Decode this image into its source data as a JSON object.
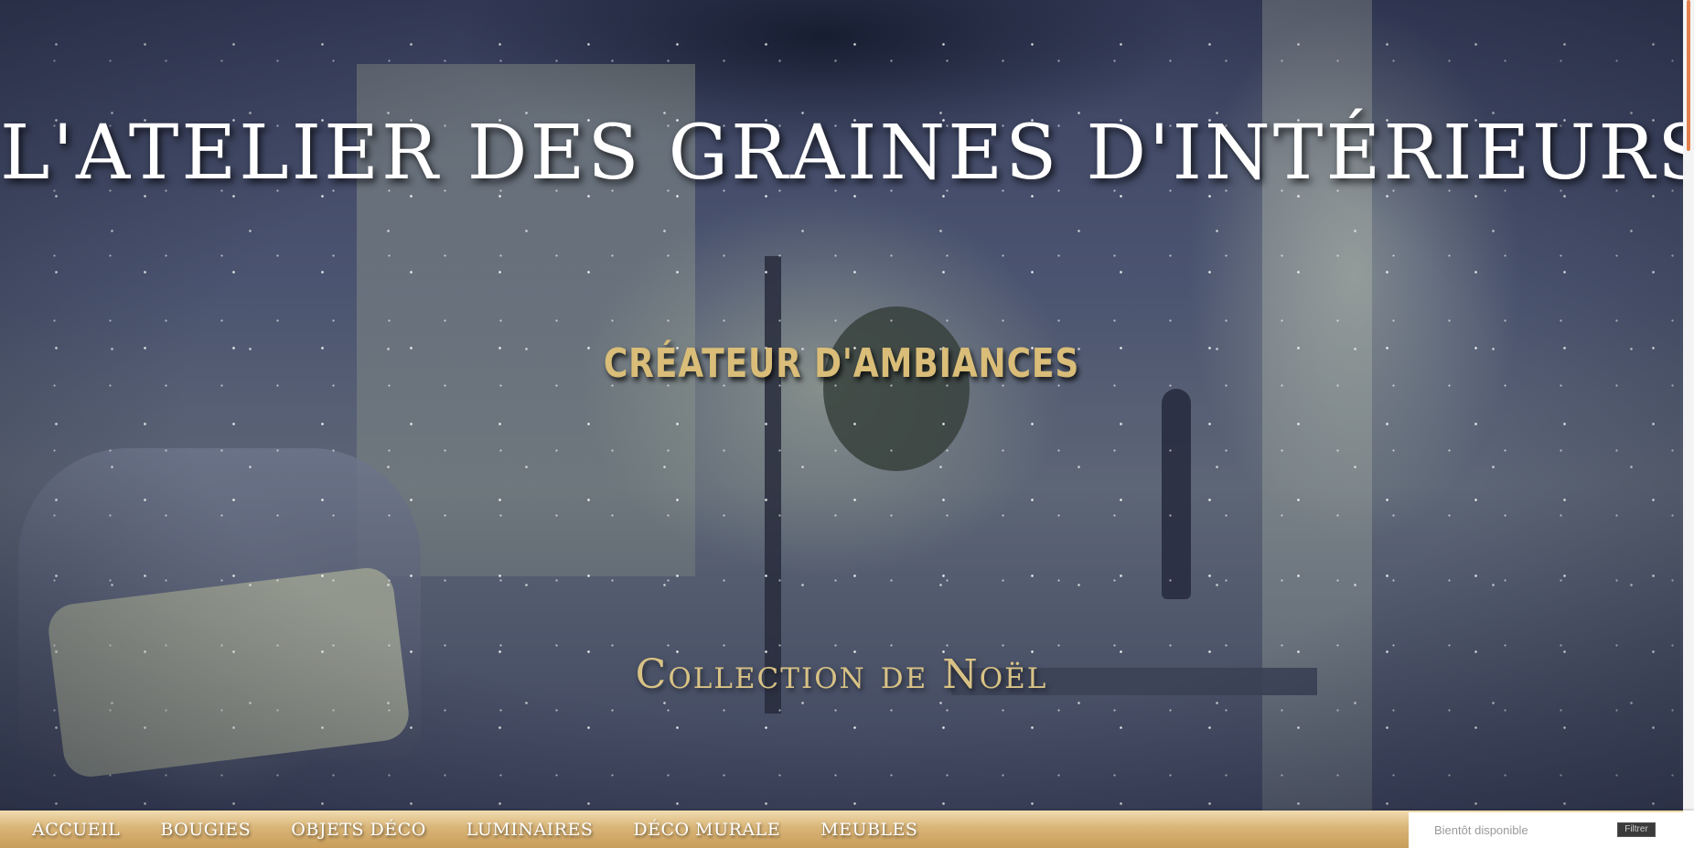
{
  "hero": {
    "title": "L'ATELIER DES GRAINES D'INTÉRIEURS",
    "subtitle": "CRÉATEUR D'AMBIANCES",
    "collection": "Collection de Noël"
  },
  "nav": {
    "items": [
      {
        "label": "ACCUEIL"
      },
      {
        "label": "BOUGIES"
      },
      {
        "label": "OBJETS DÉCO"
      },
      {
        "label": "LUMINAIRES"
      },
      {
        "label": "DÉCO MURALE"
      },
      {
        "label": "MEUBLES"
      }
    ]
  },
  "search": {
    "placeholder": "Bientôt disponible",
    "button_label": "Filtrer"
  },
  "colors": {
    "title_text": "#ffffff",
    "subtitle_gold": "#d9bd78",
    "nav_gold": "#d9b578",
    "scroll_accent": "#e3804c"
  }
}
